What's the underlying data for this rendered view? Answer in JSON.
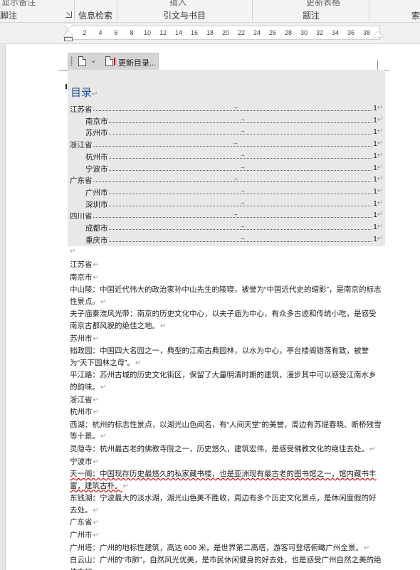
{
  "ribbon": {
    "top_fragments": [
      "显示备注",
      "插入",
      "更新表格"
    ],
    "groups": [
      "脚注",
      "信息检索",
      "引文与书目",
      "题注",
      "索"
    ]
  },
  "ruler": {
    "ticks": [
      "2",
      "4",
      "6",
      "8",
      "10",
      "12",
      "14",
      "16",
      "18",
      "20",
      "22",
      "24",
      "26",
      "28",
      "30",
      "32",
      "34",
      "36",
      "38"
    ]
  },
  "toc_control": {
    "update_label": "更新目录...",
    "title": "目录",
    "entries": [
      {
        "label": "江苏省",
        "page": "1",
        "level": 1
      },
      {
        "label": "南京市",
        "page": "1",
        "level": 2
      },
      {
        "label": "苏州市",
        "page": "1",
        "level": 2
      },
      {
        "label": "浙江省",
        "page": "1",
        "level": 1
      },
      {
        "label": "杭州市",
        "page": "1",
        "level": 2
      },
      {
        "label": "宁波市",
        "page": "1",
        "level": 2
      },
      {
        "label": "广东省",
        "page": "1",
        "level": 1
      },
      {
        "label": "广州市",
        "page": "1",
        "level": 2
      },
      {
        "label": "深圳市",
        "page": "1",
        "level": 2
      },
      {
        "label": "四川省",
        "page": "1",
        "level": 1
      },
      {
        "label": "成都市",
        "page": "1",
        "level": 2
      },
      {
        "label": "重庆市",
        "page": "1",
        "level": 2
      }
    ]
  },
  "paragraph_mark": "↵",
  "tab_arrow": "→",
  "body": [
    "江苏省",
    "南京市",
    "中山陵：中国近代伟大的政治家孙中山先生的陵寝，被誉为“中国近代史的缩影”，是南京的标志性景点。",
    "夫子庙秦淮风光带：南京的历史文化中心，以夫子庙为中心，有众多古迹和传统小吃，是感受南京古都风貌的绝佳之地。",
    "苏州市",
    "拙政园：中国四大名园之一，典型的江南古典园林，以水为中心，亭台楼阁错落有致，被誉为“天下园林之母”。",
    "平江路：苏州古城的历史文化街区，保留了大量明清时期的建筑，漫步其中可以感受江南水乡的韵味。",
    "浙江省",
    "杭州市",
    "西湖：杭州的标志性景点，以湖光山色闻名，有“人间天堂”的美誉，周边有苏堤春晓、断桥残雪等十景。",
    "灵隐寺：杭州最古老的佛教寺院之一，历史悠久，建筑宏伟，是感受佛教文化的绝佳去处。",
    "宁波市",
    "天一阁：中国现存历史最悠久的私家藏书楼，也是亚洲现有最古老的图书馆之一，馆内藏书丰富，建筑古朴。",
    "东钱湖：宁波最大的淡水湖，湖光山色美不胜收，周边有多个历史文化景点，是休闲度假的好去处。",
    "广东省",
    "广州市",
    "广州塔：广州的地标性建筑，高达 600 米，是世界第二高塔，游客可登塔俯瞰广州全景。",
    "白云山：广州的“市肺”，自然风光优美，是市民休闲健身的好去处，也是感受广州自然之美的绝佳之地。"
  ]
}
